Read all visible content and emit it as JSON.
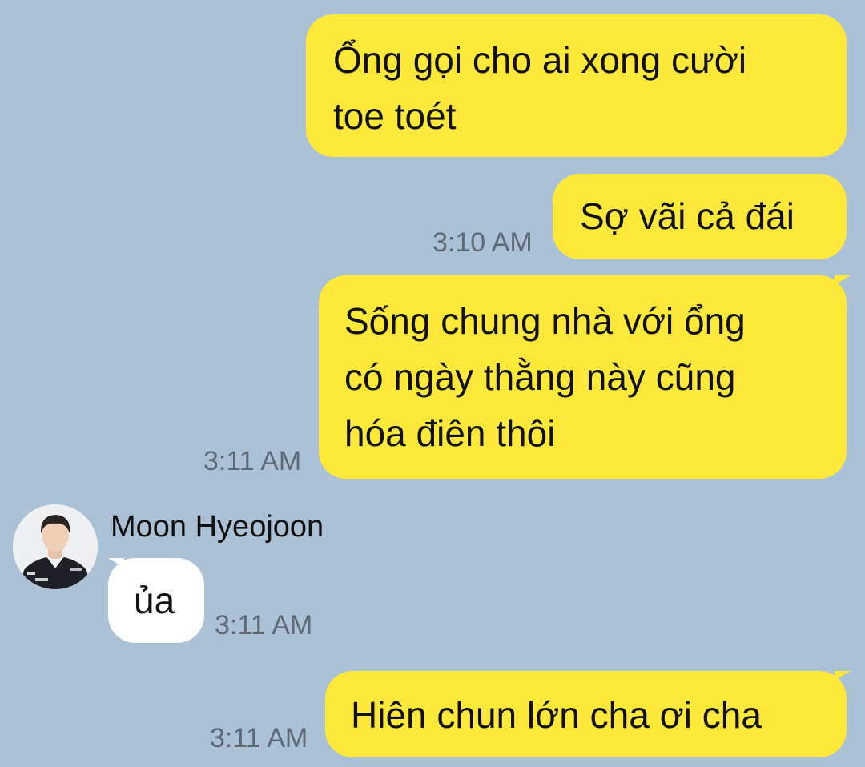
{
  "chat": {
    "contact_name": "Moon Hyeojoon",
    "messages": [
      {
        "sender": "me",
        "text": "Ổng gọi cho ai xong cười\ntoe toét",
        "time": ""
      },
      {
        "sender": "me",
        "text": "Sợ vãi cả đái",
        "time": "3:10 AM"
      },
      {
        "sender": "me",
        "text": "Sống chung nhà với ổng\ncó ngày thằng này cũng\nhóa điên thôi",
        "time": "3:11 AM"
      },
      {
        "sender": "Moon Hyeojoon",
        "text": "ủa",
        "time": "3:11 AM"
      },
      {
        "sender": "me",
        "text": "Hiên chun lớn cha ơi cha",
        "time": "3:11 AM"
      }
    ]
  },
  "colors": {
    "background": "#abc1d6",
    "my_bubble": "#fee83a",
    "their_bubble": "#ffffff",
    "timestamp": "#5f6a75"
  },
  "icons": {
    "avatar": "profile-photo-man-in-team-jacket"
  }
}
